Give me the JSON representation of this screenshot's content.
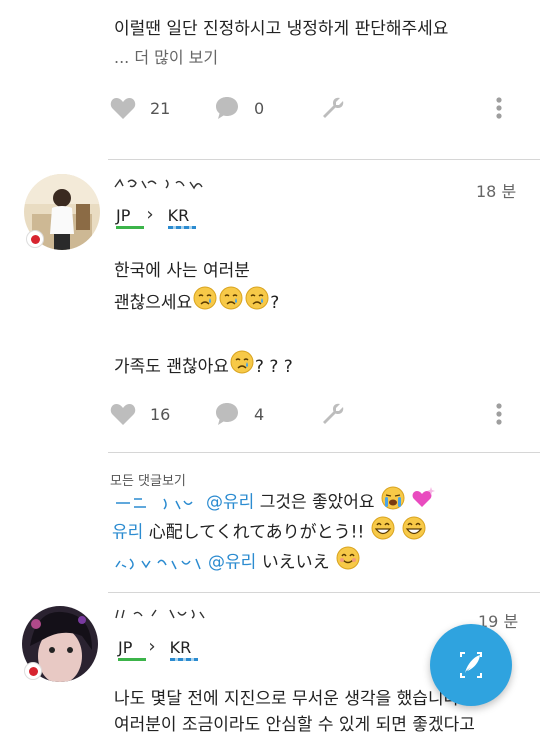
{
  "post_top": {
    "text": "이럴땐 일단 진정하시고 냉정하게 판단해주세요",
    "more_link": "... 더 많이 보기",
    "likes": "21",
    "comments": "0"
  },
  "post2": {
    "time": "18 분",
    "native_lang": "JP",
    "learning_lang": "KR",
    "lines": [
      "한국에 사는 여러분",
      "괜찮으세요",
      "?",
      "가족도 괜찮아요",
      "? ? ?"
    ],
    "likes": "16",
    "comments": "4",
    "view_all_comments": "모든 댓글보기",
    "comment_list": [
      {
        "mention": "@유리",
        "text": "그것은 좋았어요"
      },
      {
        "name": "유리",
        "text": "心配してくれてありがとう!!"
      },
      {
        "mention": "@유리",
        "text": "いえいえ"
      }
    ]
  },
  "post3": {
    "time": "19 분",
    "native_lang": "JP",
    "learning_lang": "KR",
    "lines": [
      "나도 몇달 전에 지진으로 무서운 생각을 했습니다",
      "여러분이 조금이라도 안심할 수 있게 되면 좋겠다고"
    ]
  },
  "colors": {
    "accent": "#2fa3df",
    "native_bar": "#3cb44a",
    "learning_bar": "#2b8bd0",
    "mention": "#2b8bd0",
    "flag_red": "#d7242f"
  },
  "icons": [
    "heart-icon",
    "comment-icon",
    "wrench-icon",
    "more-vertical-icon",
    "compose-quill-icon"
  ]
}
